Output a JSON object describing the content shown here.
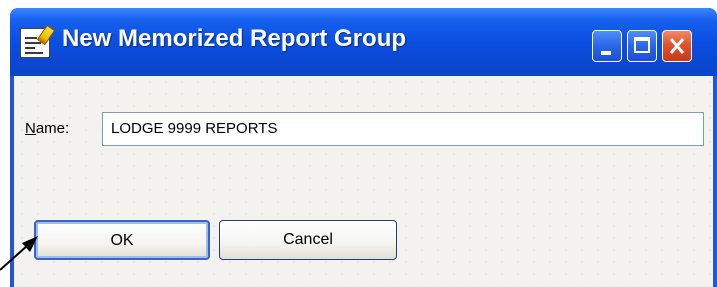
{
  "window": {
    "title": "New Memorized Report Group",
    "title_icon": "report-pencil-icon",
    "controls": {
      "minimize_icon": "minimize-icon",
      "maximize_icon": "maximize-icon",
      "close_icon": "close-icon"
    },
    "colors": {
      "titlebar": "#0a4fe0",
      "close_button": "#e0532c",
      "client_background": "#f3f2ee"
    }
  },
  "form": {
    "name_label_mnemonic": "N",
    "name_label_rest": "ame:",
    "name_value": "LODGE 9999 REPORTS"
  },
  "buttons": {
    "ok_label": "OK",
    "cancel_label": "Cancel"
  },
  "annotation": {
    "arrow_icon": "pointer-arrow-icon"
  }
}
